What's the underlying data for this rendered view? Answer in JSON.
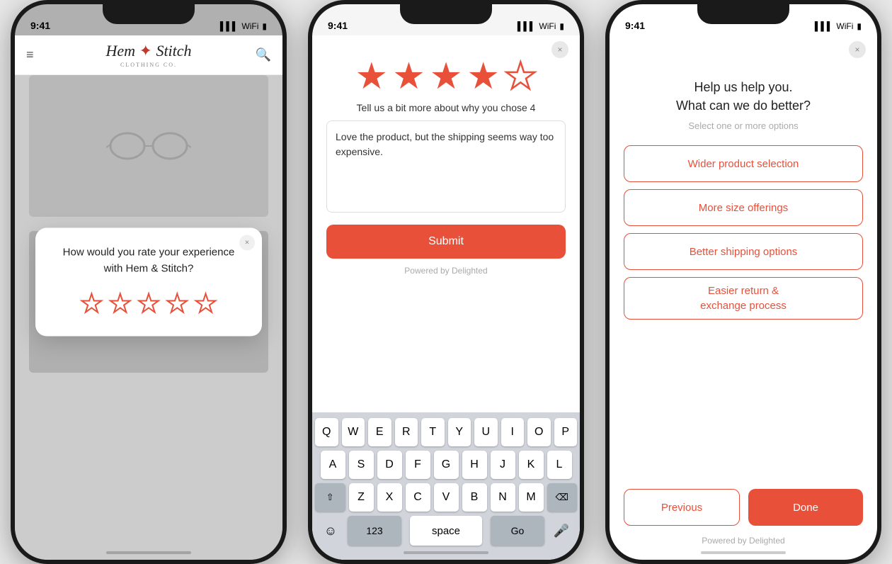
{
  "phone1": {
    "status_time": "9:41",
    "logo": "Hem & Stitch",
    "logo_sub": "CLOTHING CO.",
    "modal": {
      "question": "How would you rate your experience with Hem & Stitch?",
      "close_label": "×",
      "stars": [
        false,
        false,
        false,
        false,
        false
      ]
    }
  },
  "phone2": {
    "status_time": "9:41",
    "close_label": "×",
    "stars": [
      true,
      true,
      true,
      true,
      false
    ],
    "subtitle": "Tell us a bit more about why you chose 4",
    "textarea_value": "Love the product, but the shipping seems way too expensive.",
    "submit_label": "Submit",
    "powered_text": "Powered by Delighted",
    "keyboard": {
      "row1": [
        "Q",
        "W",
        "E",
        "R",
        "T",
        "Y",
        "U",
        "I",
        "O",
        "P"
      ],
      "row2": [
        "A",
        "S",
        "D",
        "F",
        "G",
        "H",
        "J",
        "K",
        "L"
      ],
      "row3": [
        "Z",
        "X",
        "C",
        "V",
        "B",
        "N",
        "M"
      ],
      "num_label": "123",
      "space_label": "space",
      "go_label": "Go"
    }
  },
  "phone3": {
    "status_time": "9:41",
    "close_label": "×",
    "title_line1": "Help us help you.",
    "title_line2": "What can we do better?",
    "select_hint": "Select one or more options",
    "options": [
      "Wider product selection",
      "More size offerings",
      "Better shipping options",
      "Easier return &\nexchange process"
    ],
    "prev_label": "Previous",
    "done_label": "Done",
    "powered_text": "Powered by Delighted"
  }
}
